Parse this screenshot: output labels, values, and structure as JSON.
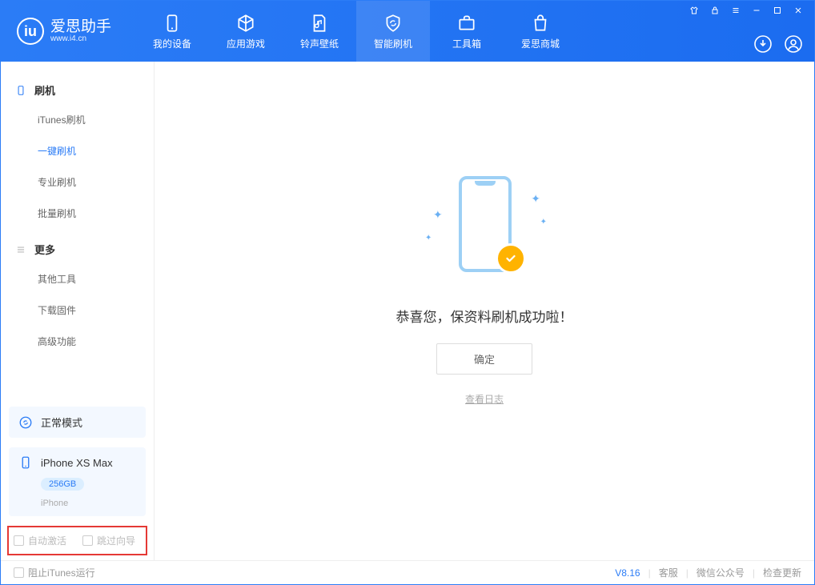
{
  "app": {
    "name": "爱思助手",
    "url": "www.i4.cn"
  },
  "nav": {
    "tabs": [
      {
        "label": "我的设备"
      },
      {
        "label": "应用游戏"
      },
      {
        "label": "铃声壁纸"
      },
      {
        "label": "智能刷机"
      },
      {
        "label": "工具箱"
      },
      {
        "label": "爱思商城"
      }
    ]
  },
  "sidebar": {
    "group1_title": "刷机",
    "group1_items": [
      "iTunes刷机",
      "一键刷机",
      "专业刷机",
      "批量刷机"
    ],
    "group2_title": "更多",
    "group2_items": [
      "其他工具",
      "下载固件",
      "高级功能"
    ],
    "mode_label": "正常模式",
    "device": {
      "name": "iPhone XS Max",
      "capacity": "256GB",
      "type": "iPhone"
    },
    "checkbox1": "自动激活",
    "checkbox2": "跳过向导"
  },
  "main": {
    "success_text": "恭喜您，保资料刷机成功啦！",
    "ok_button": "确定",
    "log_link": "查看日志"
  },
  "footer": {
    "block_itunes": "阻止iTunes运行",
    "version": "V8.16",
    "link_support": "客服",
    "link_wechat": "微信公众号",
    "link_update": "检查更新"
  }
}
